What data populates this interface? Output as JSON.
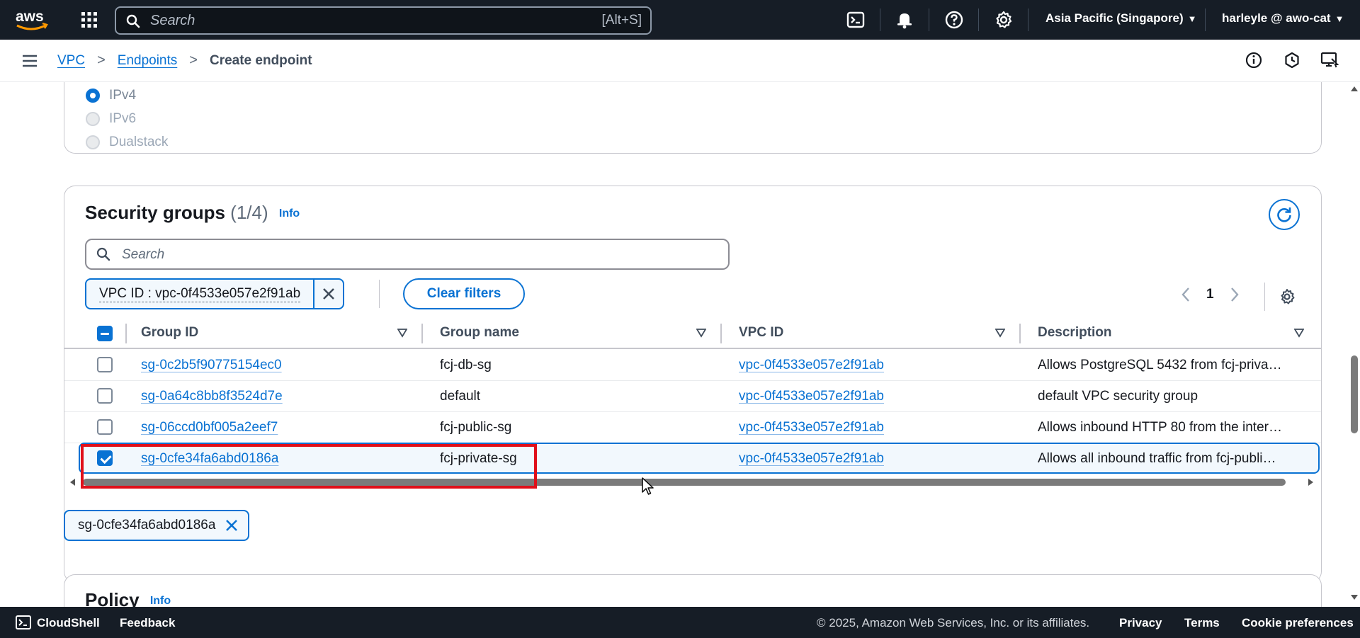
{
  "topnav": {
    "search_placeholder": "Search",
    "search_shortcut": "[Alt+S]",
    "region": "Asia Pacific (Singapore)",
    "user": "harleyle @ awo-cat"
  },
  "breadcrumb": {
    "items": [
      "VPC",
      "Endpoints"
    ],
    "current": "Create endpoint"
  },
  "ip_address_type": {
    "options": [
      "IPv4",
      "IPv6",
      "Dualstack"
    ],
    "selected": "IPv4"
  },
  "security_groups": {
    "title": "Security groups",
    "count": "(1/4)",
    "info": "Info",
    "search_placeholder": "Search",
    "filter_token": "VPC ID : vpc-0f4533e057e2f91ab",
    "clear_filters": "Clear filters",
    "page": "1",
    "columns": [
      "Group ID",
      "Group name",
      "VPC ID",
      "Description"
    ],
    "rows": [
      {
        "group_id": "sg-0c2b5f90775154ec0",
        "group_name": "fcj-db-sg",
        "vpc_id": "vpc-0f4533e057e2f91ab",
        "description": "Allows PostgreSQL 5432 from fcj-priva…",
        "selected": false
      },
      {
        "group_id": "sg-0a64c8bb8f3524d7e",
        "group_name": "default",
        "vpc_id": "vpc-0f4533e057e2f91ab",
        "description": "default VPC security group",
        "selected": false
      },
      {
        "group_id": "sg-06ccd0bf005a2eef7",
        "group_name": "fcj-public-sg",
        "vpc_id": "vpc-0f4533e057e2f91ab",
        "description": "Allows inbound HTTP 80 from the inter…",
        "selected": false
      },
      {
        "group_id": "sg-0cfe34fa6abd0186a",
        "group_name": "fcj-private-sg",
        "vpc_id": "vpc-0f4533e057e2f91ab",
        "description": "Allows all inbound traffic from fcj-publi…",
        "selected": true
      }
    ],
    "selected_token": "sg-0cfe34fa6abd0186a"
  },
  "policy": {
    "title": "Policy",
    "info": "Info"
  },
  "footer": {
    "cloudshell": "CloudShell",
    "feedback": "Feedback",
    "copyright": "© 2025, Amazon Web Services, Inc. or its affiliates.",
    "privacy": "Privacy",
    "terms": "Terms",
    "cookie": "Cookie preferences"
  },
  "colors": {
    "nav_bg": "#161d26",
    "link": "#0972d3",
    "highlight": "#e0101a"
  }
}
